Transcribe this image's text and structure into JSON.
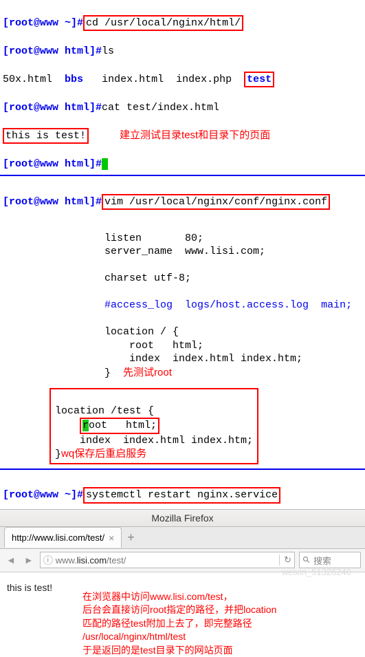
{
  "term1": {
    "p1_prefix": "[root@www ~]#",
    "p1_cmd": "cd /usr/local/nginx/html/",
    "p2_prefix": "[root@www html]#",
    "p2_cmd": "ls",
    "ls_50x": "50x.html",
    "ls_bbs": "bbs",
    "ls_index_html": "index.html",
    "ls_index_php": "index.php",
    "ls_test": "test",
    "p3_prefix": "[root@www html]#",
    "p3_cmd": "cat test/index.html",
    "output": "this is test!",
    "p4_prefix": "[root@www html]#",
    "annot1": "建立测试目录test和目录下的页面"
  },
  "term2": {
    "prefix": "[root@www html]#",
    "cmd": "vim /usr/local/nginx/conf/nginx.conf"
  },
  "conf": {
    "listen": "        listen       80;",
    "server_name": "        server_name  www.lisi.com;",
    "charset": "        charset utf-8;",
    "access_log": "        #access_log  logs/host.access.log  main;",
    "loc1_open": "        location / {",
    "loc1_root": "            root   html;",
    "loc1_index": "            index  index.html index.htm;",
    "loc1_close": "        }",
    "annot_root": "先测试root",
    "loc2_open": "location /test {",
    "loc2_root_r": "r",
    "loc2_root_rest": "oot   html;",
    "loc2_index": "    index  index.html index.htm;",
    "loc2_close": "}",
    "annot_wq": "wq保存后重启服务"
  },
  "term3": {
    "prefix": "[root@www ~]#",
    "cmd": "systemctl restart nginx.service"
  },
  "firefox": {
    "title": "Mozilla Firefox",
    "tab_title": "http://www.lisi.com/test/",
    "url_prefix": "www.",
    "url_host": "lisi.com",
    "url_suffix": "/test/",
    "search_placeholder": "搜索",
    "page_text": "this is test!"
  },
  "annot2": {
    "l1": "在浏览器中访问www.lisi.com/test，",
    "l2": "后台会直接访问root指定的路径，并把location",
    "l3": "匹配的路径test附加上去了，即完整路径",
    "l4": "/usr/local/nginx/html/test",
    "l5": "于是返回的是test目录下的网站页面"
  },
  "watermark": "weixin_51326240"
}
